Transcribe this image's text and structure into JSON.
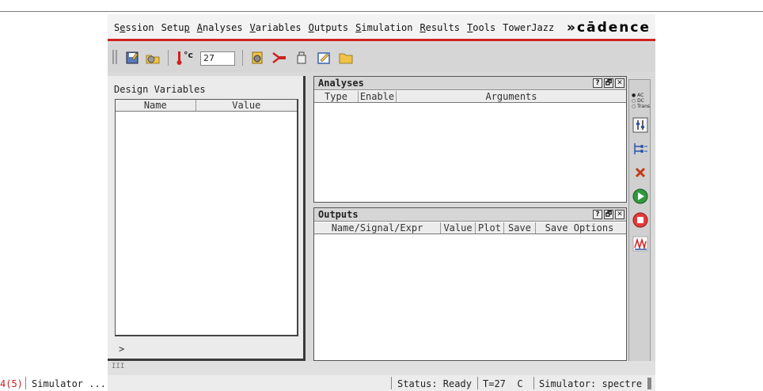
{
  "menu": [
    "Session",
    "Setup",
    "Analyses",
    "Variables",
    "Outputs",
    "Simulation",
    "Results",
    "Tools",
    "TowerJazz"
  ],
  "menu_underline": [
    1,
    4,
    0,
    0,
    0,
    0,
    0,
    0,
    -1
  ],
  "logo": "»cādence",
  "toolbar": {
    "temperature": "27",
    "temp_unit": "°c"
  },
  "design_variables": {
    "title": "Design Variables",
    "columns": [
      "Name",
      "Value"
    ],
    "chevron": ">"
  },
  "analyses": {
    "title": "Analyses",
    "columns": [
      "Type",
      "Enable",
      "Arguments"
    ],
    "btns": [
      "?",
      "🗗",
      "✕"
    ]
  },
  "outputs": {
    "title": "Outputs",
    "columns": [
      "Name/Signal/Expr",
      "Value",
      "Plot",
      "Save",
      "Save Options"
    ],
    "btns": [
      "?",
      "🗗",
      "✕"
    ]
  },
  "sidebar": {
    "ac": "AC",
    "dc": "DC",
    "trans": "Trans"
  },
  "status": {
    "counter": "4(5)",
    "msg": "Simulator ...",
    "state": "Status: Ready",
    "temp": "T=27  C",
    "simulator": "Simulator: spectre"
  },
  "colors": {
    "menu_accent": "#d42020",
    "run_green": "#2f9a3a",
    "stop_red": "#e23a3a"
  }
}
